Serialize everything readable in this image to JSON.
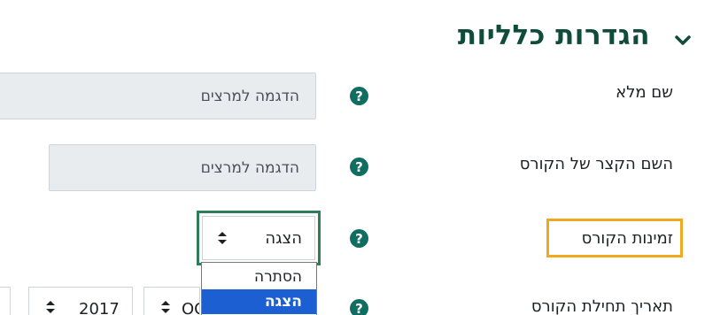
{
  "section": {
    "title": "הגדרות כלליות",
    "chevron_icon": "chevron-down-icon"
  },
  "fields": {
    "fullname": {
      "label": "שם מלא",
      "value": "הדגמה למרצים"
    },
    "shortname": {
      "label": "השם הקצר של הקורס",
      "value": "הדגמה למרצים"
    },
    "visibility": {
      "label": "זמינות הקורס",
      "value": "הצגה",
      "options": [
        "הסתרה",
        "הצגה"
      ]
    },
    "startdate": {
      "label": "תאריך תחילת הקורס",
      "year": "2017",
      "month": "OC"
    }
  },
  "help_icon_glyph": "?",
  "colors": {
    "accent": "#0f4c3a",
    "help": "#0f6e61",
    "highlight": "#f0a81e",
    "selected": "#1c5fd2"
  }
}
